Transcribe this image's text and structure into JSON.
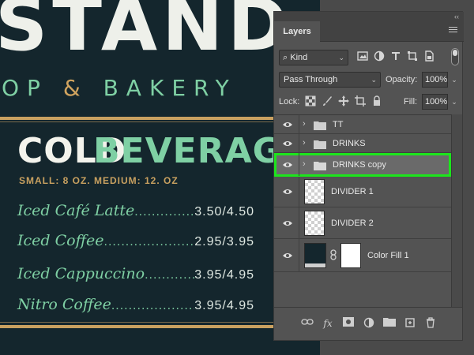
{
  "artwork": {
    "heading_fragment": "STAND",
    "subheading_left": "OP",
    "subheading_amp": "&",
    "subheading_right": "BAKERY",
    "section_title_a": "COLD",
    "section_title_b": "BEVERAGES",
    "sizes": "SMALL: 8 OZ. MEDIUM: 12. OZ",
    "items": [
      {
        "name": "Iced Café Latte",
        "price": "3.50/4.50"
      },
      {
        "name": "Iced Coffee",
        "price": "2.95/3.95"
      },
      {
        "name": "Iced Cappuccino",
        "price": "3.95/4.95"
      },
      {
        "name": "Nitro Coffee",
        "price": "3.95/4.95"
      }
    ],
    "colors": {
      "background": "#14262d",
      "mint": "#7fd0a4",
      "gold": "#caa160",
      "cream": "#eef0ea"
    }
  },
  "panel": {
    "collapse_glyph": "‹‹",
    "tab_label": "Layers",
    "filter": {
      "search_glyph": "⌕",
      "kind_label": "Kind"
    },
    "blend_mode": "Pass Through",
    "opacity_label": "Opacity:",
    "opacity_value": "100%",
    "lock_label": "Lock:",
    "fill_label": "Fill:",
    "fill_value": "100%",
    "chevron_right": "›",
    "chevron_down": "⌄",
    "layers": [
      {
        "name": "TT",
        "type": "group",
        "visible": true,
        "selected": false
      },
      {
        "name": "DRINKS",
        "type": "group",
        "visible": true,
        "selected": false
      },
      {
        "name": "DRINKS copy",
        "type": "group",
        "visible": true,
        "selected": true
      },
      {
        "name": "DIVIDER 1",
        "type": "pixel",
        "visible": true,
        "selected": false
      },
      {
        "name": "DIVIDER 2",
        "type": "pixel",
        "visible": true,
        "selected": false
      },
      {
        "name": "Color Fill 1",
        "type": "fill",
        "visible": true,
        "selected": false
      }
    ],
    "highlight_color": "#1ce51c"
  }
}
